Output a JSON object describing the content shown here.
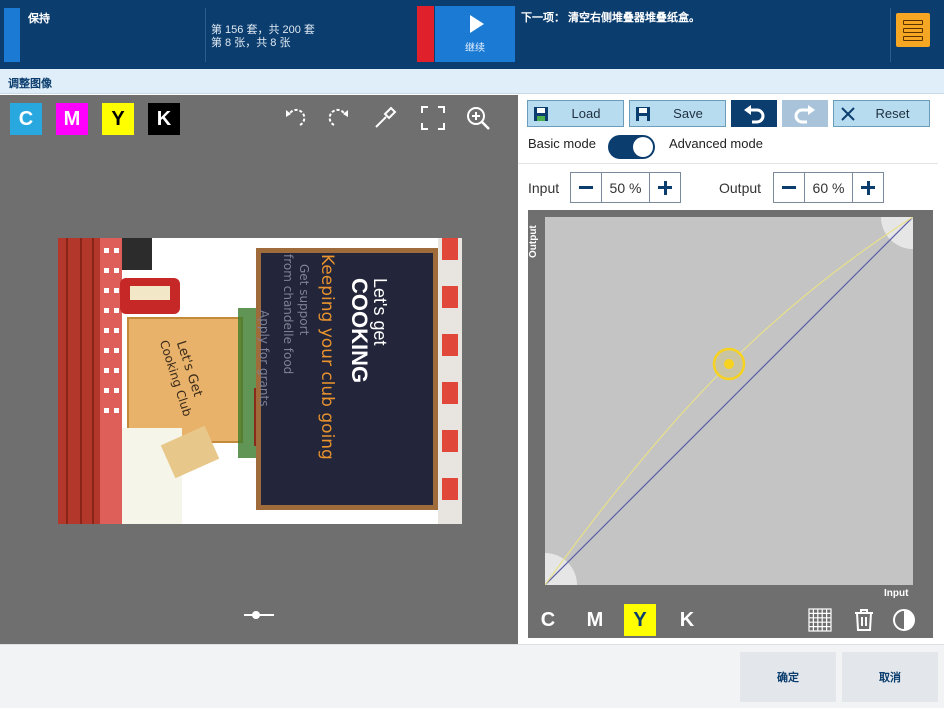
{
  "topbar": {
    "status": "保持",
    "set_progress": "第 156 套，共 200 套",
    "sheet_progress": "第 8 张，共 8 张",
    "continue_label": "继续",
    "next_step": "下一项： 清空右侧堆叠器堆叠纸盒。",
    "menu_icon": "stacker-menu-icon"
  },
  "subbar": {
    "title": "调整图像"
  },
  "left_panel": {
    "channels": [
      {
        "label": "C",
        "color": "#29a8e0"
      },
      {
        "label": "M",
        "color": "#ff00ff"
      },
      {
        "label": "Y",
        "color": "#ffff00"
      },
      {
        "label": "K",
        "color": "#000000"
      }
    ],
    "tools": [
      "rotate-left-icon",
      "rotate-right-icon",
      "eyedropper-icon",
      "fit-to-screen-icon",
      "zoom-in-icon"
    ],
    "preview": {
      "brand_line1": "Let's get",
      "brand_line2": "COOKING",
      "headline": "Keeping your club going",
      "sub1": "Get support",
      "sub2": "from chandelle food",
      "sub3": "Apply for grants",
      "card_line1": "Let's Get",
      "card_line2": "Cooking Club"
    }
  },
  "right_panel": {
    "toolbar": {
      "load_label": "Load",
      "save_label": "Save",
      "reset_label": "Reset"
    },
    "mode": {
      "basic_label": "Basic mode",
      "advanced_label": "Advanced mode"
    },
    "input": {
      "label": "Input",
      "value": "50 %"
    },
    "output": {
      "label": "Output",
      "value": "60 %"
    },
    "curve": {
      "y_axis_label": "Output",
      "x_axis_label": "Input",
      "channels": [
        "C",
        "M",
        "Y",
        "K"
      ],
      "selected_channel": "Y",
      "selected_point": {
        "input": 50,
        "output": 60
      }
    }
  },
  "bottom": {
    "ok_label": "确定",
    "cancel_label": "取消"
  }
}
